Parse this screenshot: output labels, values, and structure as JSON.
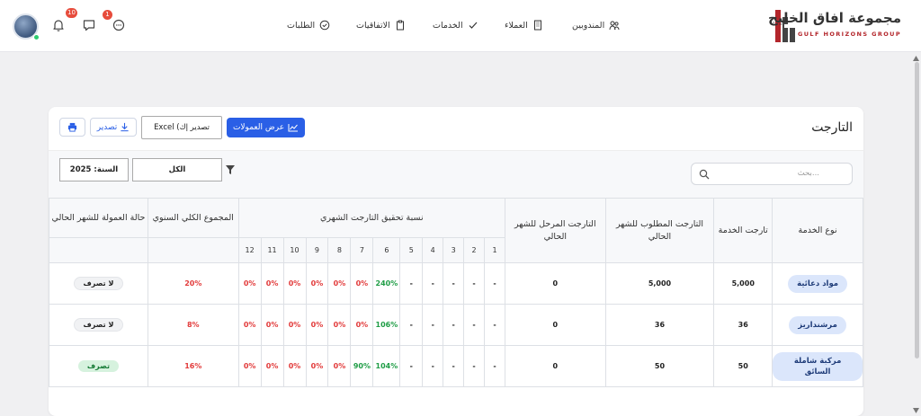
{
  "brand": {
    "name_ar": "مجموعة افاق الخليج",
    "name_en": "GULF HORIZONS GROUP",
    "accent": "#b3262b"
  },
  "nav": {
    "items": [
      {
        "label": "المندوبين",
        "icon": "users-icon"
      },
      {
        "label": "العملاء",
        "icon": "building-icon"
      },
      {
        "label": "الخدمات",
        "icon": "check-icon"
      },
      {
        "label": "الاتفاقيات",
        "icon": "clipboard-icon"
      },
      {
        "label": "الطلبات",
        "icon": "check-circle-icon"
      }
    ]
  },
  "header_icons": {
    "chat_badge": "1",
    "messages_badge": "",
    "notifications_badge": "10"
  },
  "page": {
    "title": "التارجت",
    "show_commissions": "عرض العمولات",
    "excel_label": "Excel (تصدير إك",
    "export_label": "تصدير",
    "search_placeholder": "بحث...",
    "filter_all": "الكل",
    "year_label": "السنة: 2025"
  },
  "table": {
    "headers": {
      "service_type": "نوع الخدمة",
      "service_target": "تارجت الخدمة",
      "required_target": "التارجت المطلوب للشهر الحالي",
      "carried_target": "التارجت المرحل للشهر الحالي",
      "monthly_achievement": "نسبة تحقيق التارجت الشهري",
      "yearly_total": "المجموع الكلي السنوي",
      "commission_status": "حالة العمولة للشهر الحالي"
    },
    "months": [
      "1",
      "2",
      "3",
      "4",
      "5",
      "6",
      "7",
      "8",
      "9",
      "10",
      "11",
      "12"
    ],
    "rows": [
      {
        "service": "مواد دعائية",
        "service_target": "5,000",
        "required": "5,000",
        "carried": "0",
        "months": [
          "-",
          "-",
          "-",
          "-",
          "-",
          "240%",
          "0%",
          "0%",
          "0%",
          "0%",
          "0%",
          "0%"
        ],
        "yearly": "20%",
        "status": "لا تصرف",
        "status_ok": false
      },
      {
        "service": "مرشنداريز",
        "service_target": "36",
        "required": "36",
        "carried": "0",
        "months": [
          "-",
          "-",
          "-",
          "-",
          "-",
          "106%",
          "0%",
          "0%",
          "0%",
          "0%",
          "0%",
          "0%"
        ],
        "yearly": "8%",
        "status": "لا تصرف",
        "status_ok": false
      },
      {
        "service": "مركبة شاملة السائق",
        "service_target": "50",
        "required": "50",
        "carried": "0",
        "months": [
          "-",
          "-",
          "-",
          "-",
          "-",
          "104%",
          "90%",
          "0%",
          "0%",
          "0%",
          "0%",
          "0%"
        ],
        "yearly": "16%",
        "status": "تصرف",
        "status_ok": true
      }
    ]
  },
  "colors": {
    "primary": "#2a5fe6",
    "positive": "#1f9d46",
    "negative": "#e23b3b"
  }
}
